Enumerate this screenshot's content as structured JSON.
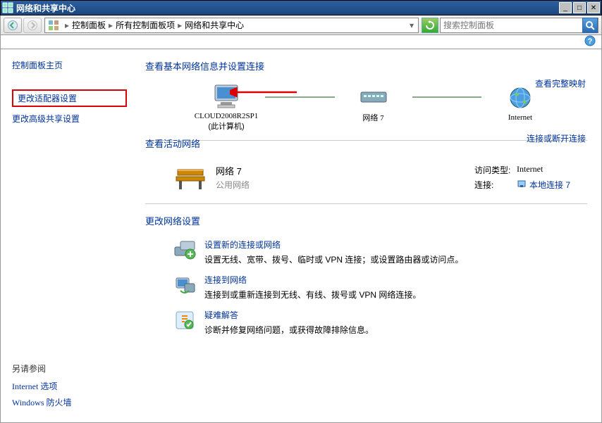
{
  "titlebar": {
    "title": "网络和共享中心"
  },
  "breadcrumb": {
    "part1": "控制面板",
    "part2": "所有控制面板项",
    "part3": "网络和共享中心"
  },
  "search": {
    "placeholder": "搜索控制面板"
  },
  "sidebar": {
    "home": "控制面板主页",
    "link_adapter": "更改适配器设置",
    "link_sharing": "更改高级共享设置",
    "see_also_title": "另请参阅",
    "see_also_inet": "Internet 选项",
    "see_also_fw": "Windows 防火墙"
  },
  "main": {
    "header": "查看基本网络信息并设置连接",
    "full_map": "查看完整映射",
    "node_pc": "CLOUD2008R2SP1",
    "node_pc_sub": "(此计算机)",
    "node_net": "网络  7",
    "node_internet": "Internet",
    "active_title": "查看活动网络",
    "conn_discon": "连接或断开连接",
    "net_name": "网络  7",
    "net_type": "公用网络",
    "access_label": "访问类型:",
    "access_value": "Internet",
    "conn_label": "连接:",
    "conn_value": "本地连接 7",
    "change_title": "更改网络设置",
    "s1_link": "设置新的连接或网络",
    "s1_desc": "设置无线、宽带、拨号、临时或 VPN 连接；或设置路由器或访问点。",
    "s2_link": "连接到网络",
    "s2_desc": "连接到或重新连接到无线、有线、拨号或 VPN 网络连接。",
    "s3_link": "疑难解答",
    "s3_desc": "诊断并修复网络问题，或获得故障排除信息。"
  }
}
